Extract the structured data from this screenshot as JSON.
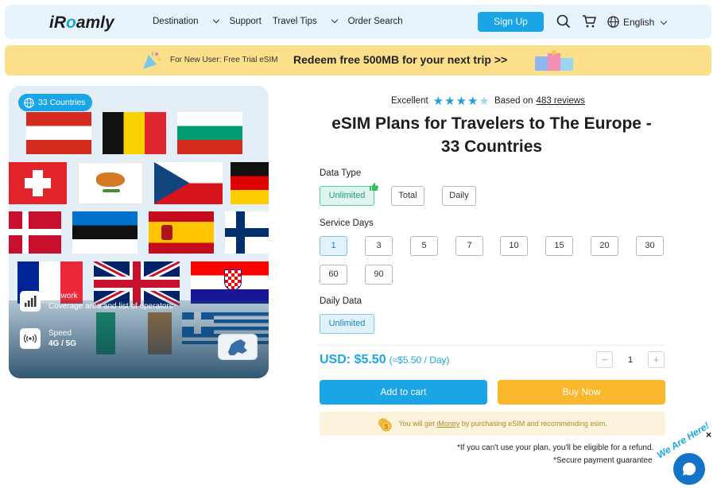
{
  "nav": {
    "logo_prefix": "iR",
    "logo_o": "o",
    "logo_suffix": "amly",
    "destination": "Destination",
    "support": "Support",
    "travel_tips": "Travel Tips",
    "order_search": "Order Search",
    "signup": "Sign Up",
    "language": "English"
  },
  "banner": {
    "small_text": "For New User: Free Trial eSIM",
    "big_text": "Redeem free 500MB for your next trip >>"
  },
  "gallery": {
    "countries_badge": "33 Countries",
    "network_title": "Network",
    "network_desc": "Coverage area and list of operators",
    "speed_title": "Speed",
    "speed_value": "4G / 5G"
  },
  "rating": {
    "label": "Excellent",
    "stars": 4.5,
    "based_on": "Based on",
    "reviews": "483 reviews"
  },
  "product": {
    "title_line1": "eSIM Plans for Travelers to The Europe -",
    "title_line2": "33 Countries"
  },
  "data_type": {
    "label": "Data Type",
    "options": [
      "Unlimited",
      "Total",
      "Daily"
    ],
    "selected": "Unlimited"
  },
  "service_days": {
    "label": "Service Days",
    "options": [
      "1",
      "3",
      "5",
      "7",
      "10",
      "15",
      "20",
      "30",
      "60",
      "90"
    ],
    "selected": "1"
  },
  "daily_data": {
    "label": "Daily Data",
    "options": [
      "Unlimited"
    ],
    "selected": "Unlimited"
  },
  "price": {
    "main": "USD: $5.50",
    "per_day": "(≈$5.50 / Day)"
  },
  "quantity": {
    "minus": "−",
    "value": "1",
    "plus": "+"
  },
  "buttons": {
    "add_to_cart": "Add to cart",
    "buy_now": "Buy Now"
  },
  "imoney": {
    "prefix": "You will get",
    "link": "iMoney",
    "suffix": "by purchasing eSIM and recommending esim."
  },
  "notes": {
    "refund": "*If you can't use your plan, you'll be eligible for a refund.",
    "secure": "*Secure payment guarantee"
  },
  "chat": {
    "label": "We Are Here!",
    "close": "×"
  },
  "colors": {
    "accent": "#1aa6e6",
    "buy": "#fbb72c",
    "banner": "#fcdf8b",
    "nav_bg": "#e8f4fb"
  }
}
